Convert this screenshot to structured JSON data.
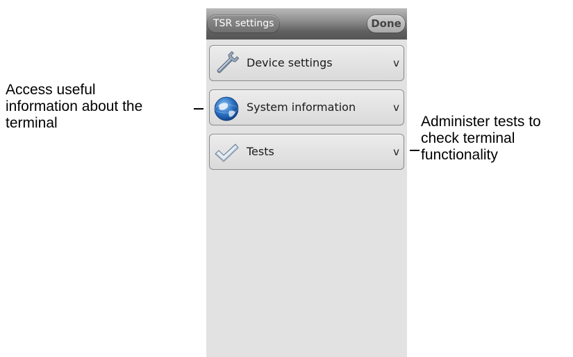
{
  "header": {
    "back_label": "TSR settings",
    "done_label": "Done"
  },
  "menu": {
    "items": [
      {
        "label": "Device settings",
        "icon": "wrench-icon",
        "chevron": "v"
      },
      {
        "label": "System information",
        "icon": "globe-icon",
        "chevron": "v"
      },
      {
        "label": "Tests",
        "icon": "checkmark-icon",
        "chevron": "v"
      }
    ]
  },
  "annotations": {
    "left_lines": [
      "Access useful",
      "information about the",
      "terminal"
    ],
    "right_lines": [
      "Administer tests to",
      "check terminal",
      "functionality"
    ]
  },
  "colors": {
    "screen_background": "#e2e2e2",
    "title_bar_dark": "#555555",
    "item_border": "#8a8a8a",
    "globe_blue": "#1f5fb0"
  }
}
